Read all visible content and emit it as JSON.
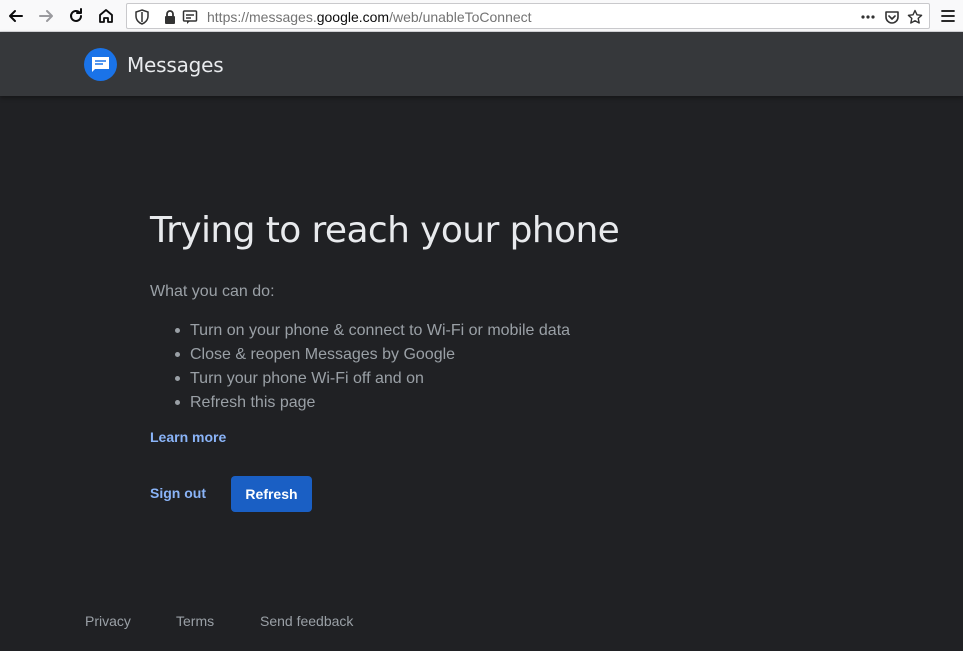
{
  "browser": {
    "url_prefix": "https://messages.",
    "url_domain": "google.com",
    "url_path": "/web/unableToConnect",
    "icons": [
      "back-icon",
      "forward-icon",
      "reload-icon",
      "home-icon",
      "shield-icon",
      "lock-icon",
      "permissions-icon",
      "page-actions-icon",
      "pocket-icon",
      "bookmark-star-icon",
      "menu-icon"
    ]
  },
  "header": {
    "title": "Messages"
  },
  "main": {
    "heading": "Trying to reach your phone",
    "subheading": "What you can do:",
    "tips": [
      "Turn on your phone & connect to Wi-Fi or mobile data",
      "Close & reopen Messages by Google",
      "Turn your phone Wi-Fi off and on",
      "Refresh this page"
    ],
    "learn_more": "Learn more",
    "sign_out": "Sign out",
    "refresh": "Refresh"
  },
  "footer": {
    "privacy": "Privacy",
    "terms": "Terms",
    "feedback": "Send feedback"
  },
  "colors": {
    "background": "#202124",
    "header": "#36383b",
    "accent": "#8ab4f8",
    "button": "#1a5fc4",
    "logo": "#1a73e8"
  }
}
